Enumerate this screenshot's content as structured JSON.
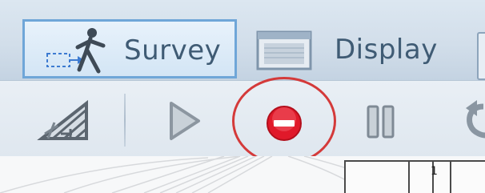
{
  "tabs": {
    "survey": {
      "label": "Survey",
      "icon": "survey-walker-icon",
      "active": true
    },
    "display": {
      "label": "Display",
      "icon": "display-screen-icon"
    }
  },
  "toolbar": {
    "buttons": [
      {
        "name": "grid-settings-button",
        "icon": "grid-triangle-icon"
      },
      {
        "name": "play-button",
        "icon": "play-icon"
      },
      {
        "name": "stop-button",
        "icon": "stop-sign-icon",
        "highlighted": true
      },
      {
        "name": "pause-button",
        "icon": "pause-icon"
      },
      {
        "name": "undo-button",
        "icon": "undo-arrow-icon"
      }
    ]
  },
  "ruler": {
    "marker_number": "1"
  },
  "colors": {
    "accent_border": "#6fa6d8",
    "tab_text": "#3f5b74",
    "stop_red": "#e0192a",
    "annotation_ring": "#d43a3a"
  }
}
